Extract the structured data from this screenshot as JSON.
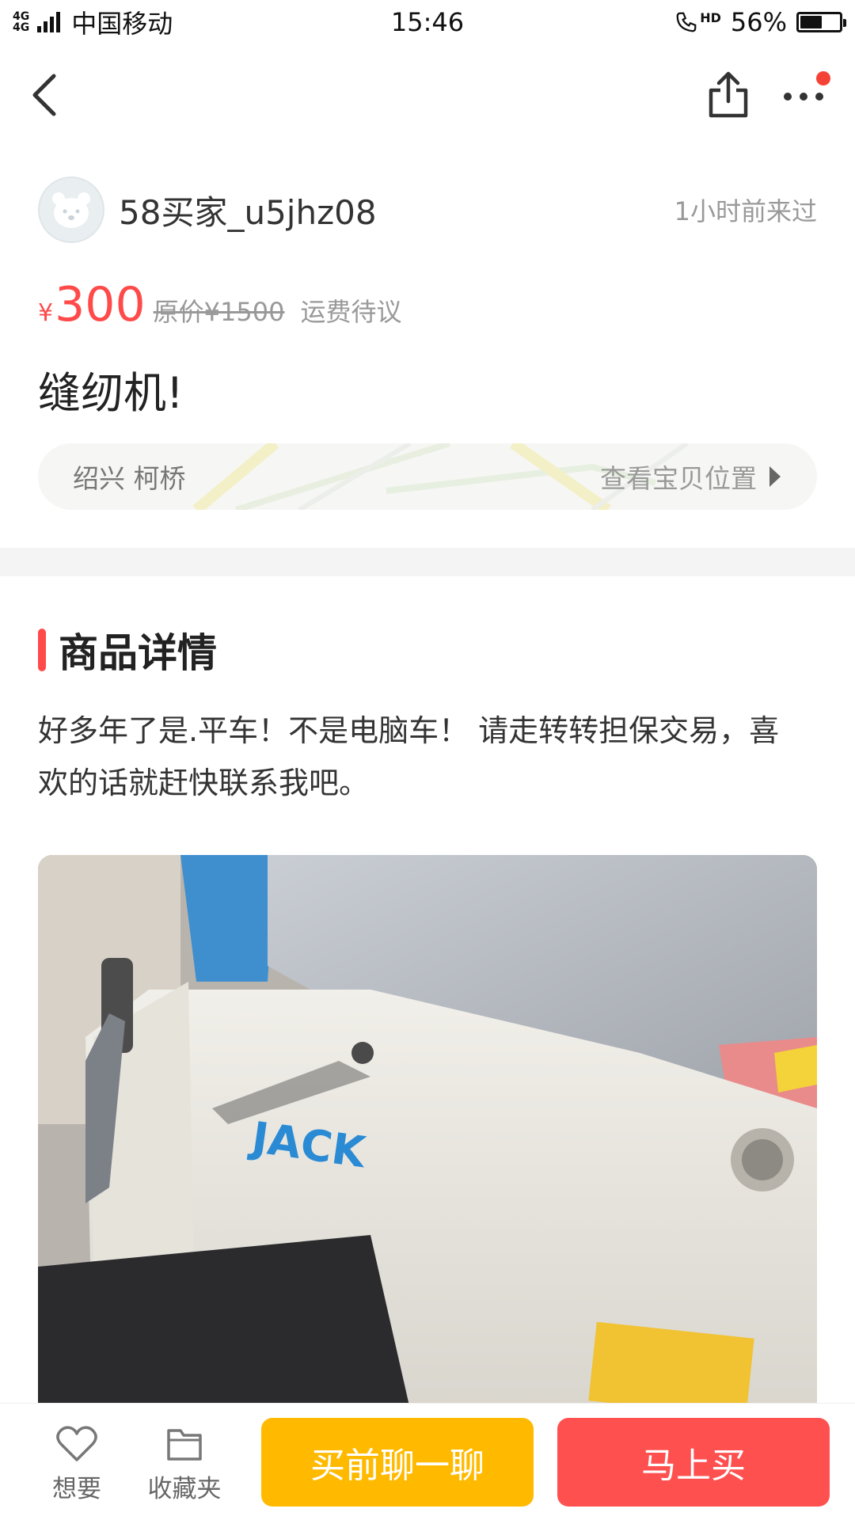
{
  "status_bar": {
    "network_top": "4G",
    "network_bottom": "4G",
    "carrier": "中国移动",
    "time": "15:46",
    "hd_label": "HD",
    "battery_percent": "56%",
    "battery_level": 0.56
  },
  "nav": {
    "back_icon": "chevron-left-icon",
    "share_icon": "share-icon",
    "more_icon": "more-dots-icon",
    "notification_dot_color": "#f44336"
  },
  "seller": {
    "name": "58买家_u5jhz08",
    "last_seen": "1小时前来过"
  },
  "item": {
    "currency_symbol": "¥",
    "price": "300",
    "original_price": "原价¥1500",
    "shipping": "运费待议",
    "title": "缝纫机!",
    "location": "绍兴 柯桥",
    "location_link": "查看宝贝位置"
  },
  "details": {
    "section_title": "商品详情",
    "description": "好多年了是.平车！不是电脑车！ 请走转转担保交易，喜欢的话就赶快联系我吧。",
    "photo_brand": "JACK"
  },
  "bottom_bar": {
    "want_label": "想要",
    "favorites_label": "收藏夹",
    "chat_button": "买前聊一聊",
    "buy_button": "马上买"
  },
  "colors": {
    "accent_red": "#ff4a4a",
    "chat_yellow": "#ffba00",
    "buy_red": "#ff5050"
  }
}
